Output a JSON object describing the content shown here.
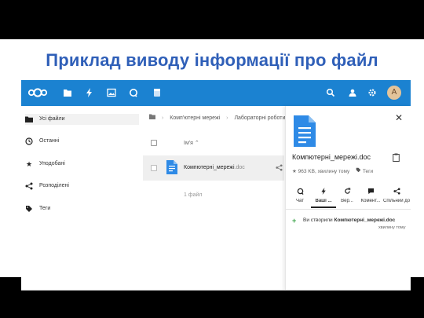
{
  "slide": {
    "title": "Приклад виводу інформації про файл"
  },
  "app": {
    "colors": {
      "topbar": "#1b82d1",
      "doc_icon": "#2e8ae6",
      "add_activity": "#3aa348"
    },
    "topbar_icons": [
      "nextcloud-logo",
      "files-icon",
      "activity-icon",
      "gallery-icon",
      "talk-icon",
      "notes-icon",
      "search-icon",
      "contacts-icon",
      "settings-icon"
    ],
    "avatar_letter": "A"
  },
  "sidebar": {
    "items": [
      {
        "label": "Усі файли",
        "icon": "folder-icon",
        "active": true
      },
      {
        "label": "Останні",
        "icon": "clock-icon"
      },
      {
        "label": "Уподобані",
        "icon": "star-icon"
      },
      {
        "label": "Розподілені",
        "icon": "share-icon"
      },
      {
        "label": "Теги",
        "icon": "tag-icon"
      }
    ]
  },
  "files": {
    "breadcrumbs": [
      "Комп'ютерні мережі",
      "Лабораторні роботи"
    ],
    "column_name": "Ім'я ⌃",
    "row": {
      "name": "Компютерні_мережі",
      "ext": ".doc"
    },
    "summary": "1 файл"
  },
  "details": {
    "title": "Компютерні_мережі.doc",
    "meta_star": "★",
    "meta_size_time": "963 KB, хвилину тому",
    "meta_tags": "Теги",
    "close": "✕",
    "tabs": [
      {
        "label": "Чат",
        "icon": "chat-icon"
      },
      {
        "label": "Ваші ...",
        "icon": "activity-icon",
        "active": true
      },
      {
        "label": "Вер...",
        "icon": "versions-icon"
      },
      {
        "label": "Комент...",
        "icon": "comments-icon"
      },
      {
        "label": "Спільний доступ",
        "icon": "sharing-icon"
      }
    ],
    "activity": {
      "text_prefix": "Ви створили ",
      "text_file": "Компютерні_мережі.doc",
      "when": "хвилину тому"
    }
  }
}
